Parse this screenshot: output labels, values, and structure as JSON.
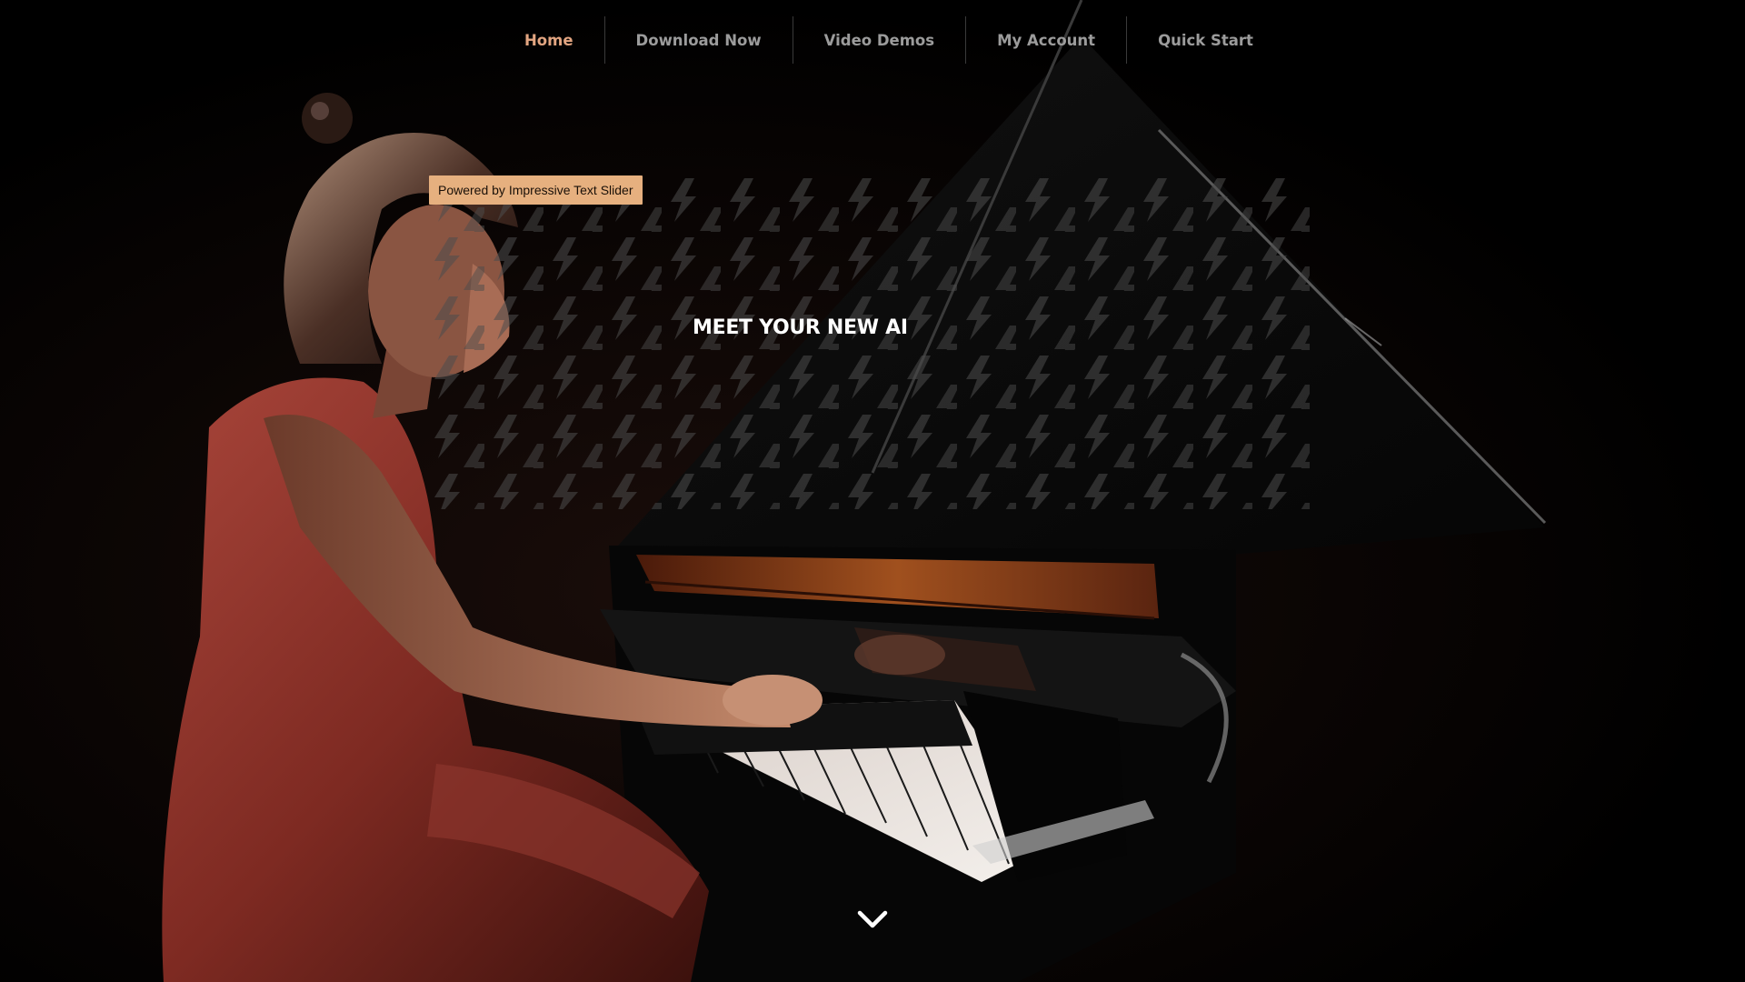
{
  "nav": {
    "items": [
      {
        "label": "Home",
        "active": true
      },
      {
        "label": "Download Now",
        "active": false
      },
      {
        "label": "Video Demos",
        "active": false
      },
      {
        "label": "My Account",
        "active": false
      },
      {
        "label": "Quick Start",
        "active": false
      }
    ]
  },
  "slider": {
    "powered_by": "Powered by Impressive Text Slider",
    "title": "MEET YOUR NEW AI"
  },
  "scroll": {
    "icon": "chevron-down-icon"
  },
  "colors": {
    "accent": "#e2a581",
    "badge_bg": "#e6b07f",
    "nav_text": "#9c9c9c",
    "background": "#000000",
    "dress": "#8a2e26"
  }
}
